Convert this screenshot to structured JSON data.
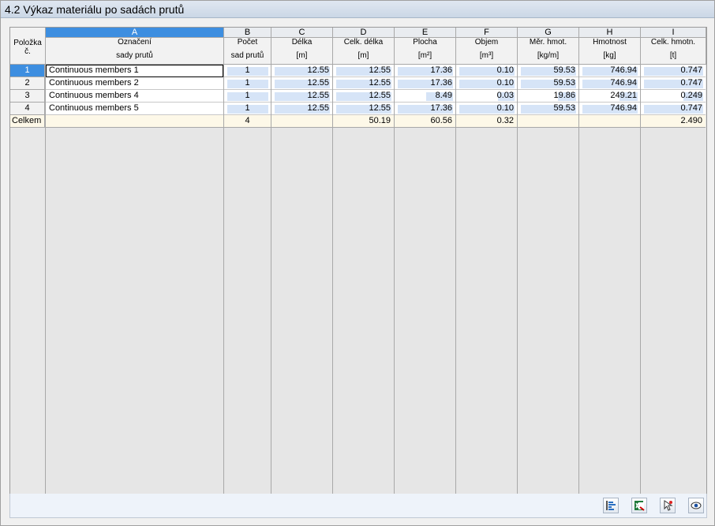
{
  "title": "4.2 Výkaz materiálu po sadách prutů",
  "columns": {
    "item": {
      "h1": "Položka",
      "h2": "č."
    },
    "A": {
      "letter": "A",
      "h1": "Označení",
      "h2": "sady prutů"
    },
    "B": {
      "letter": "B",
      "h1": "Počet",
      "h2": "sad prutů"
    },
    "C": {
      "letter": "C",
      "h1": "Délka",
      "h2": "[m]"
    },
    "D": {
      "letter": "D",
      "h1": "Celk. délka",
      "h2": "[m]"
    },
    "E": {
      "letter": "E",
      "h1": "Plocha",
      "h2": "[m²]"
    },
    "F": {
      "letter": "F",
      "h1": "Objem",
      "h2": "[m³]"
    },
    "G": {
      "letter": "G",
      "h1": "Měr. hmot.",
      "h2": "[kg/m]"
    },
    "H": {
      "letter": "H",
      "h1": "Hmotnost",
      "h2": "[kg]"
    },
    "I": {
      "letter": "I",
      "h1": "Celk. hmotn.",
      "h2": "[t]"
    }
  },
  "rows": [
    {
      "no": "1",
      "A": "Continuous members 1",
      "B": "1",
      "C": "12.55",
      "D": "12.55",
      "E": "17.36",
      "F": "0.10",
      "G": "59.53",
      "H": "746.94",
      "I": "0.747"
    },
    {
      "no": "2",
      "A": "Continuous members 2",
      "B": "1",
      "C": "12.55",
      "D": "12.55",
      "E": "17.36",
      "F": "0.10",
      "G": "59.53",
      "H": "746.94",
      "I": "0.747"
    },
    {
      "no": "3",
      "A": "Continuous members 4",
      "B": "1",
      "C": "12.55",
      "D": "12.55",
      "E": "8.49",
      "F": "0.03",
      "G": "19.86",
      "H": "249.21",
      "I": "0.249"
    },
    {
      "no": "4",
      "A": "Continuous members 5",
      "B": "1",
      "C": "12.55",
      "D": "12.55",
      "E": "17.36",
      "F": "0.10",
      "G": "59.53",
      "H": "746.94",
      "I": "0.747"
    }
  ],
  "bar_fractions": {
    "B": [
      1,
      1,
      1,
      1
    ],
    "C": [
      1,
      1,
      1,
      1
    ],
    "D": [
      1,
      1,
      1,
      1
    ],
    "E": [
      1,
      1,
      0.49,
      1
    ],
    "F": [
      1,
      1,
      0.3,
      1
    ],
    "G": [
      1,
      1,
      0.33,
      1
    ],
    "H": [
      1,
      1,
      0.33,
      1
    ],
    "I": [
      1,
      1,
      0.33,
      1
    ]
  },
  "total": {
    "label": "Celkem",
    "B": "4",
    "D": "50.19",
    "E": "60.56",
    "F": "0.32",
    "I": "2.490"
  },
  "footer_icons": [
    "bar-display-icon",
    "excel-export-icon",
    "select-pointer-icon",
    "view-eye-icon"
  ],
  "colors": {
    "selection": "#3d8ee0",
    "bar": "#d6e4f7",
    "title_bg": "#cbd7e6",
    "total_row": "#fdf8e8"
  }
}
